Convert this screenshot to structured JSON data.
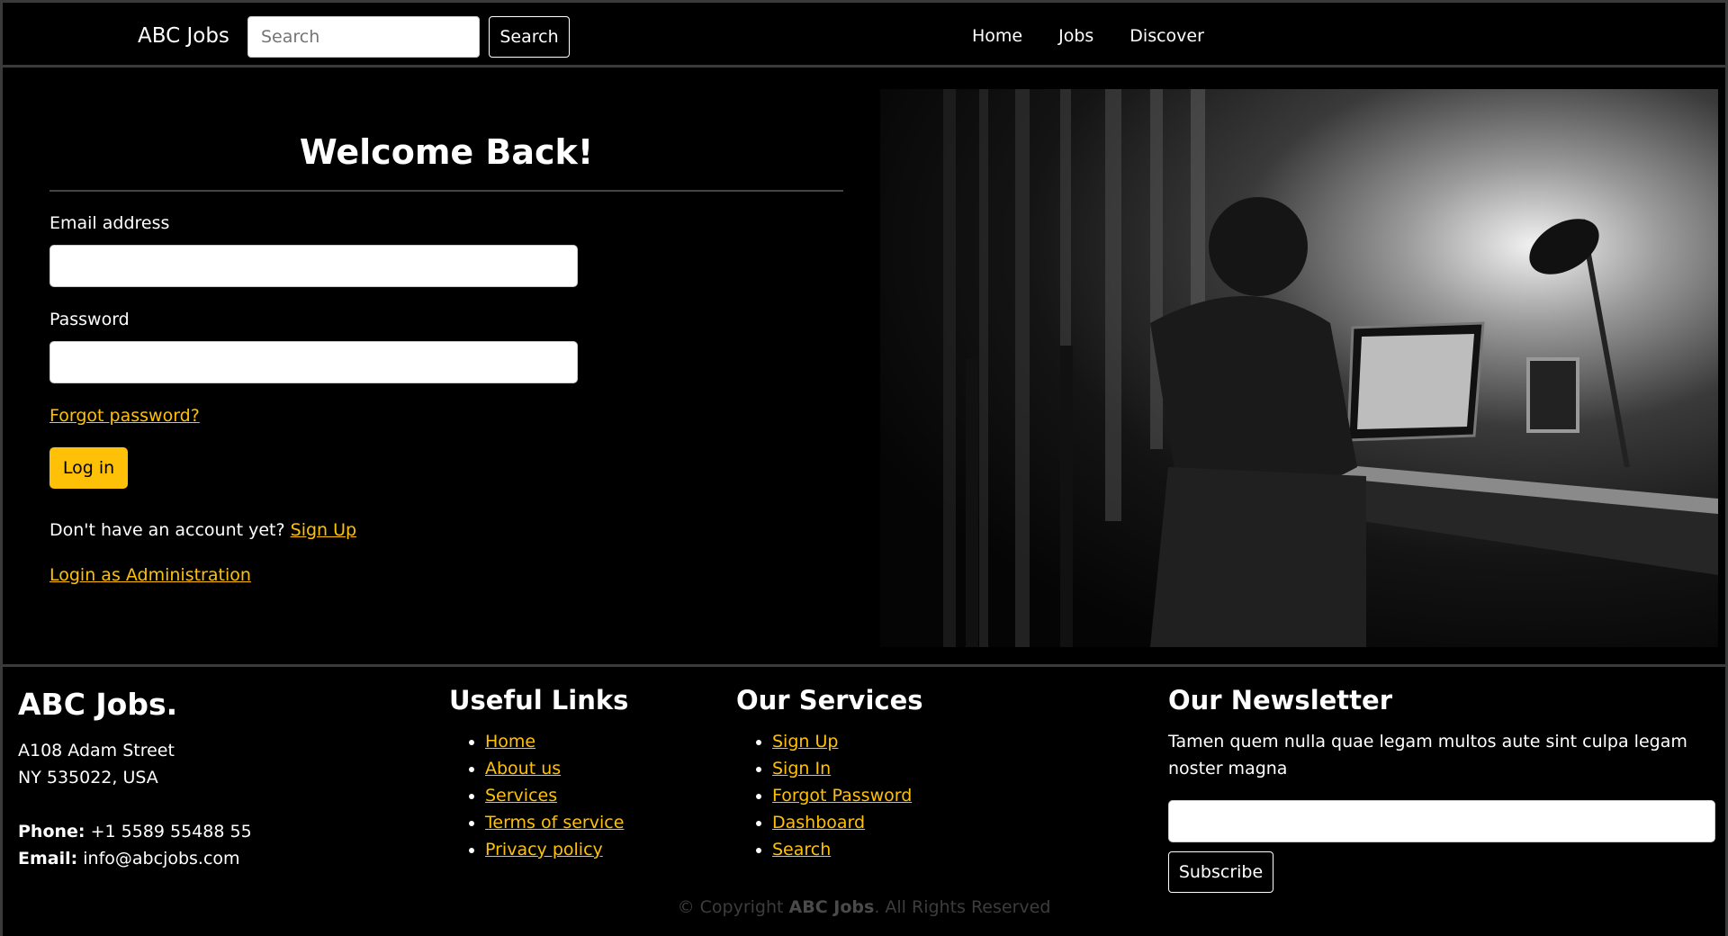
{
  "navbar": {
    "brand": "ABC Jobs",
    "search_placeholder": "Search",
    "search_button": "Search",
    "links": [
      "Home",
      "Jobs",
      "Discover"
    ]
  },
  "login": {
    "title": "Welcome Back!",
    "email_label": "Email address",
    "password_label": "Password",
    "forgot": "Forgot password?",
    "login_button": "Log in",
    "no_account": "Don't have an account yet?",
    "sign_up": "Sign Up",
    "admin_login": "Login as Administration"
  },
  "footer": {
    "brand": "ABC Jobs.",
    "address_line1": "A108 Adam Street",
    "address_line2": "NY 535022, USA",
    "phone_label": "Phone:",
    "phone": "+1 5589 55488 55",
    "email_label": "Email:",
    "email": "info@abcjobs.com",
    "useful_title": "Useful Links",
    "useful_links": [
      "Home",
      "About us",
      "Services",
      "Terms of service",
      "Privacy policy"
    ],
    "services_title": "Our Services",
    "services_links": [
      "Sign Up",
      "Sign In",
      "Forgot Password",
      "Dashboard",
      "Search"
    ],
    "newsletter_title": "Our Newsletter",
    "newsletter_text": "Tamen quem nulla quae legam multos aute sint culpa legam noster magna",
    "subscribe_button": "Subscribe",
    "copyright_prefix": "© Copyright",
    "copyright_brand": "ABC Jobs",
    "copyright_suffix": ". All Rights Reserved"
  },
  "colors": {
    "accent": "#ffc107",
    "background": "#000000",
    "border": "#3a3a3a"
  }
}
